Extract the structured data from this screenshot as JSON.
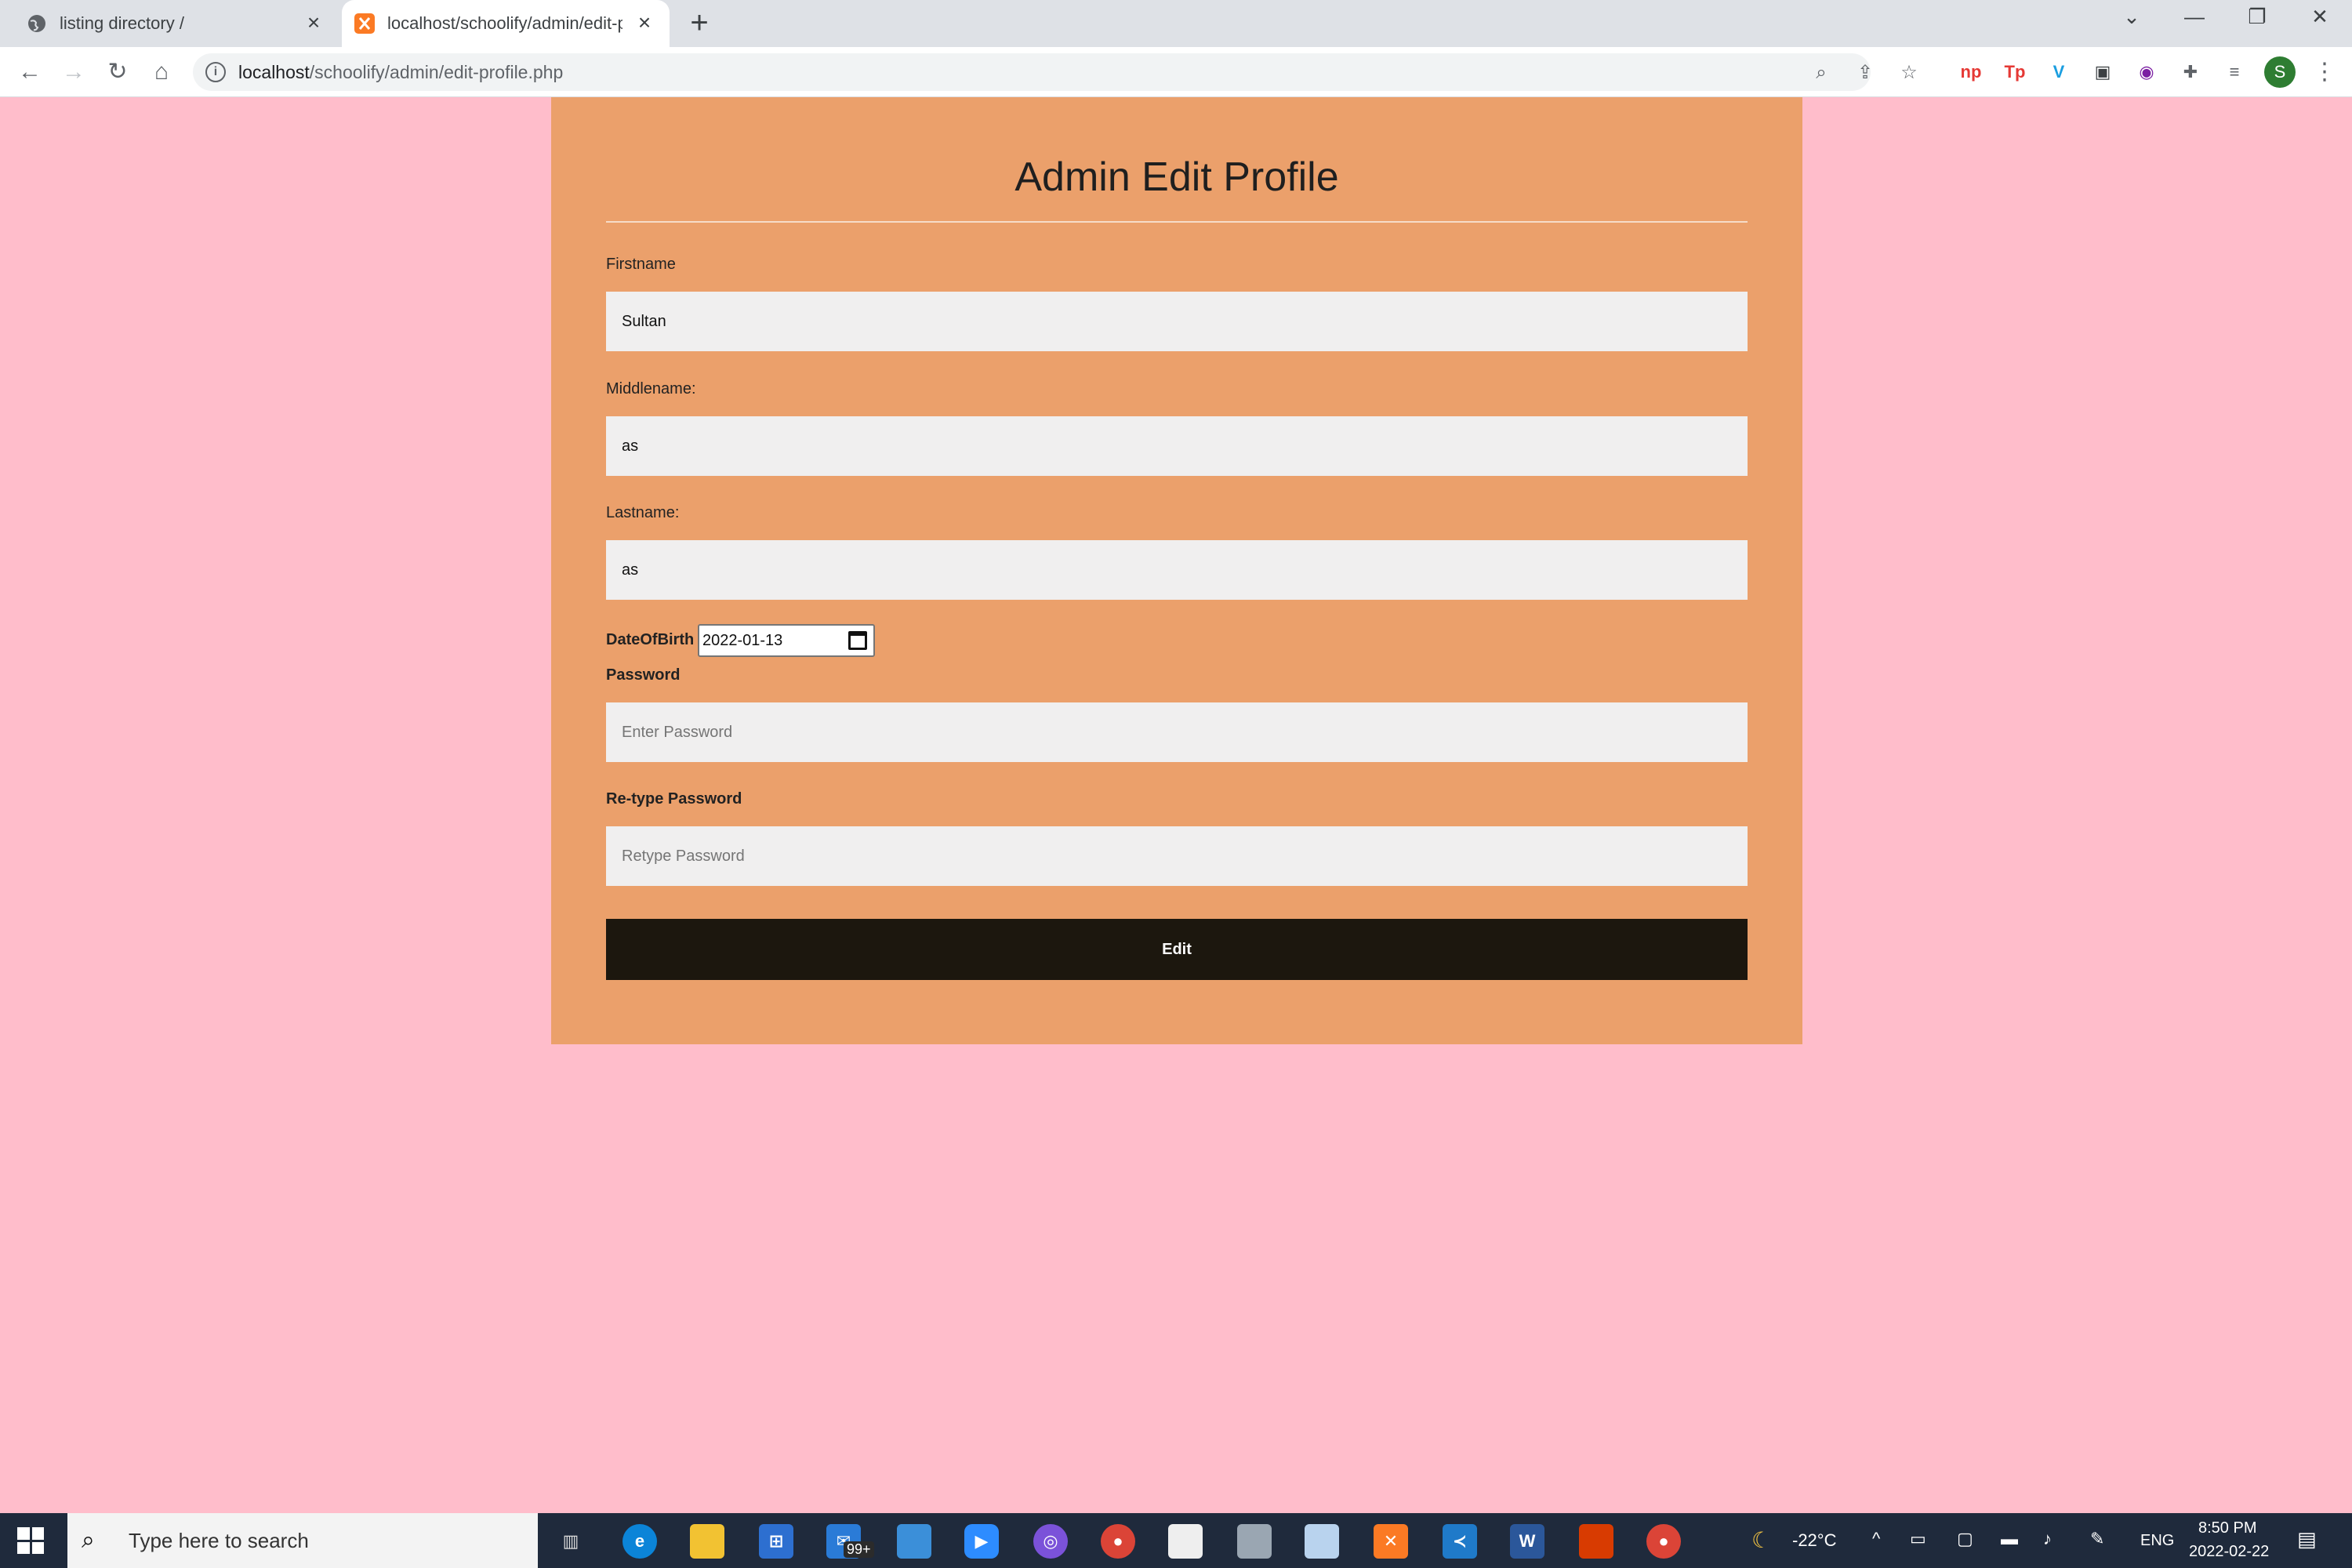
{
  "browser": {
    "tabs": [
      {
        "title": "listing directory /",
        "icon": "globe-icon"
      },
      {
        "title": "localhost/schoolify/admin/edit-p",
        "icon": "xampp-icon"
      }
    ],
    "url_host": "localhost",
    "url_path": "/schoolify/admin/edit-profile.php",
    "profile_initial": "S",
    "extensions": [
      "np",
      "Tp",
      "V"
    ]
  },
  "form": {
    "title": "Admin Edit Profile",
    "firstname_label": "Firstname",
    "firstname_value": "Sultan",
    "middlename_label": "Middlename:",
    "middlename_value": "as",
    "lastname_label": "Lastname:",
    "lastname_value": "as",
    "dob_label": "DateOfBirth",
    "dob_value": "2022-01-13",
    "password_label": "Password",
    "password_placeholder": "Enter Password",
    "retype_label": "Re-type Password",
    "retype_placeholder": "Retype Password",
    "submit_label": "Edit"
  },
  "colors": {
    "page_background": "#ffbdcb",
    "card_background": "#eba06b",
    "button_background": "#1c170e"
  },
  "taskbar": {
    "search_placeholder": "Type here to search",
    "mail_badge": "99+",
    "weather": "-22°C",
    "language": "ENG",
    "time": "8:50 PM",
    "date": "2022-02-22"
  }
}
